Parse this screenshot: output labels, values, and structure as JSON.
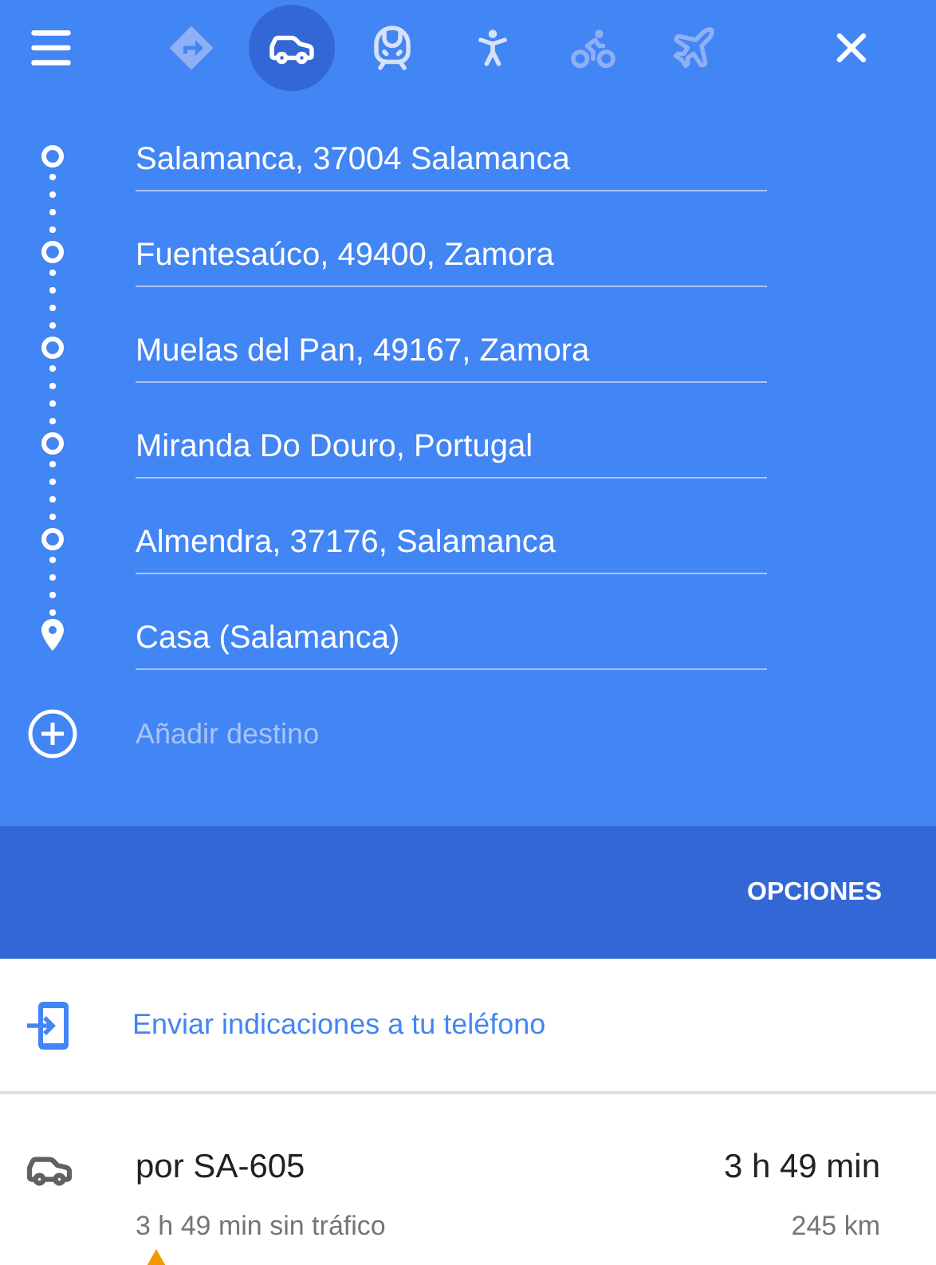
{
  "modes": [
    {
      "kind": "directions",
      "selected": false,
      "disabled": true
    },
    {
      "kind": "car",
      "selected": true,
      "disabled": false
    },
    {
      "kind": "transit",
      "selected": false,
      "disabled": false
    },
    {
      "kind": "walk",
      "selected": false,
      "disabled": false
    },
    {
      "kind": "bike",
      "selected": false,
      "disabled": true
    },
    {
      "kind": "flight",
      "selected": false,
      "disabled": true
    }
  ],
  "stops": [
    {
      "kind": "waypoint",
      "value": "Salamanca, 37004 Salamanca"
    },
    {
      "kind": "waypoint",
      "value": "Fuentesaúco, 49400, Zamora"
    },
    {
      "kind": "waypoint",
      "value": "Muelas del Pan, 49167, Zamora"
    },
    {
      "kind": "waypoint",
      "value": "Miranda Do Douro, Portugal"
    },
    {
      "kind": "waypoint",
      "value": "Almendra, 37176, Salamanca"
    },
    {
      "kind": "destination",
      "value": "Casa (Salamanca)"
    }
  ],
  "add_destination": {
    "placeholder": "Añadir destino"
  },
  "options_button": "OPCIONES",
  "send_link": "Enviar indicaciones a tu teléfono",
  "route": {
    "via": "por SA-605",
    "duration": "3 h 49 min",
    "without_traffic": "3 h 49 min sin tráfico",
    "distance": "245 km",
    "warning": true
  }
}
